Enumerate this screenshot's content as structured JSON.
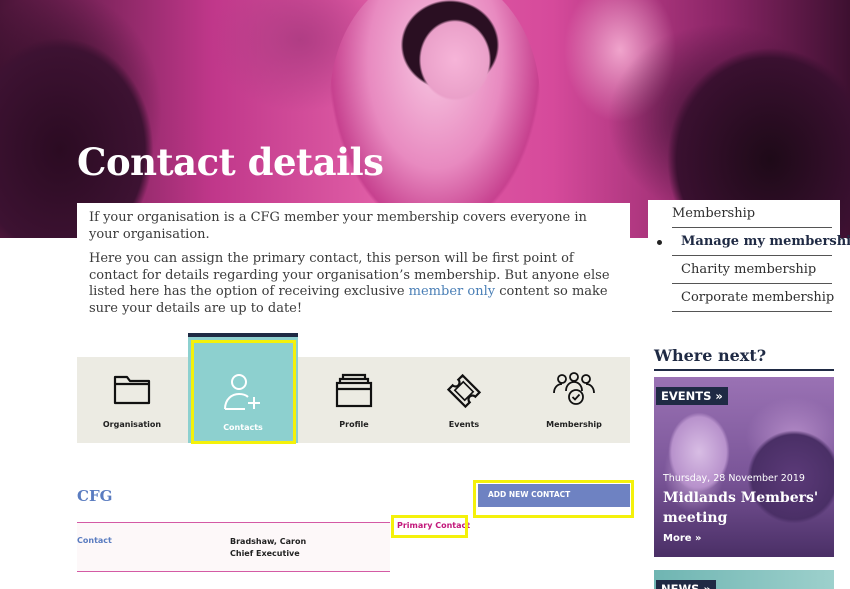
{
  "hero": {
    "title": "Contact details"
  },
  "intro": {
    "p1": "If your organisation is a CFG member your membership covers everyone in your organisation.",
    "p2_before": "Here you can assign the primary contact, this person will be first point of contact for details regarding your organisation’s membership. But anyone else listed here has the option of receiving exclusive ",
    "p2_link": "member only",
    "p2_after": " content so make sure your details are up to date!"
  },
  "sidenav": {
    "items": [
      {
        "label": "Membership"
      },
      {
        "label": "Manage my membership"
      },
      {
        "label": "Charity membership"
      },
      {
        "label": "Corporate membership"
      }
    ]
  },
  "where_next": {
    "heading": "Where next?",
    "card": {
      "tag": "EVENTS »",
      "date": "Thursday, 28 November 2019",
      "title": "Midlands Members' meeting",
      "more": "More »"
    },
    "card2": {
      "tag": "NEWS »"
    }
  },
  "tabs": [
    {
      "label": "Organisation",
      "icon": "folder-icon"
    },
    {
      "label": "Contacts",
      "icon": "add-user-icon"
    },
    {
      "label": "Profile",
      "icon": "folders-icon"
    },
    {
      "label": "Events",
      "icon": "ticket-icon"
    },
    {
      "label": "Membership",
      "icon": "group-icon"
    }
  ],
  "org": {
    "name": "CFG",
    "add_button": "ADD NEW CONTACT",
    "primary_label": "Primary Contact",
    "contact": {
      "label": "Contact",
      "name": "Bradshaw, Caron",
      "role": "Chief Executive"
    }
  },
  "colors": {
    "hero_magenta": "#e15fa7",
    "navy": "#1f2a44",
    "active_tab": "#8dd0cf",
    "link_blue": "#4a7fb6",
    "button_blue": "#6e82c2",
    "highlight_yellow": "#f4f10a",
    "primary_pink": "#c2187b"
  }
}
